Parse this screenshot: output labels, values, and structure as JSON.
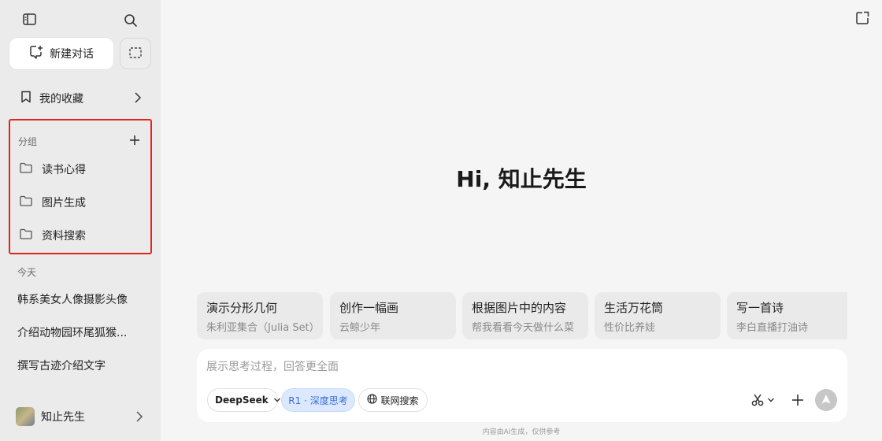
{
  "sidebar": {
    "new_chat_label": "新建对话",
    "favorites_label": "我的收藏",
    "groups": {
      "heading": "分组",
      "items": [
        {
          "label": "读书心得"
        },
        {
          "label": "图片生成"
        },
        {
          "label": "资料搜索"
        }
      ]
    },
    "today_heading": "今天",
    "history": [
      {
        "label": "韩系美女人像摄影头像"
      },
      {
        "label": "介绍动物园环尾狐猴..."
      },
      {
        "label": "撰写古迹介绍文字"
      }
    ],
    "user_name": "知止先生"
  },
  "main": {
    "greeting": "Hi, 知止先生",
    "suggestions": [
      {
        "title": "演示分形几何",
        "subtitle": "朱利亚集合（Julia Set）"
      },
      {
        "title": "创作一幅画",
        "subtitle": "云鲸少年"
      },
      {
        "title": "根据图片中的内容",
        "subtitle": "帮我看看今天做什么菜"
      },
      {
        "title": "生活万花筒",
        "subtitle": "性价比养娃"
      },
      {
        "title": "写一首诗",
        "subtitle": "李白直播打油诗"
      }
    ],
    "composer": {
      "placeholder": "展示思考过程，回答更全面",
      "model_label": "DeepSeek",
      "r1_label": "R1 · 深度思考",
      "web_search_label": "联网搜索"
    },
    "footer": "内容由AI生成，仅供参考"
  },
  "colors": {
    "highlight_border": "#e0261b",
    "r1_pill_bg": "#dbe8ff",
    "r1_pill_text": "#3b6fd4"
  }
}
